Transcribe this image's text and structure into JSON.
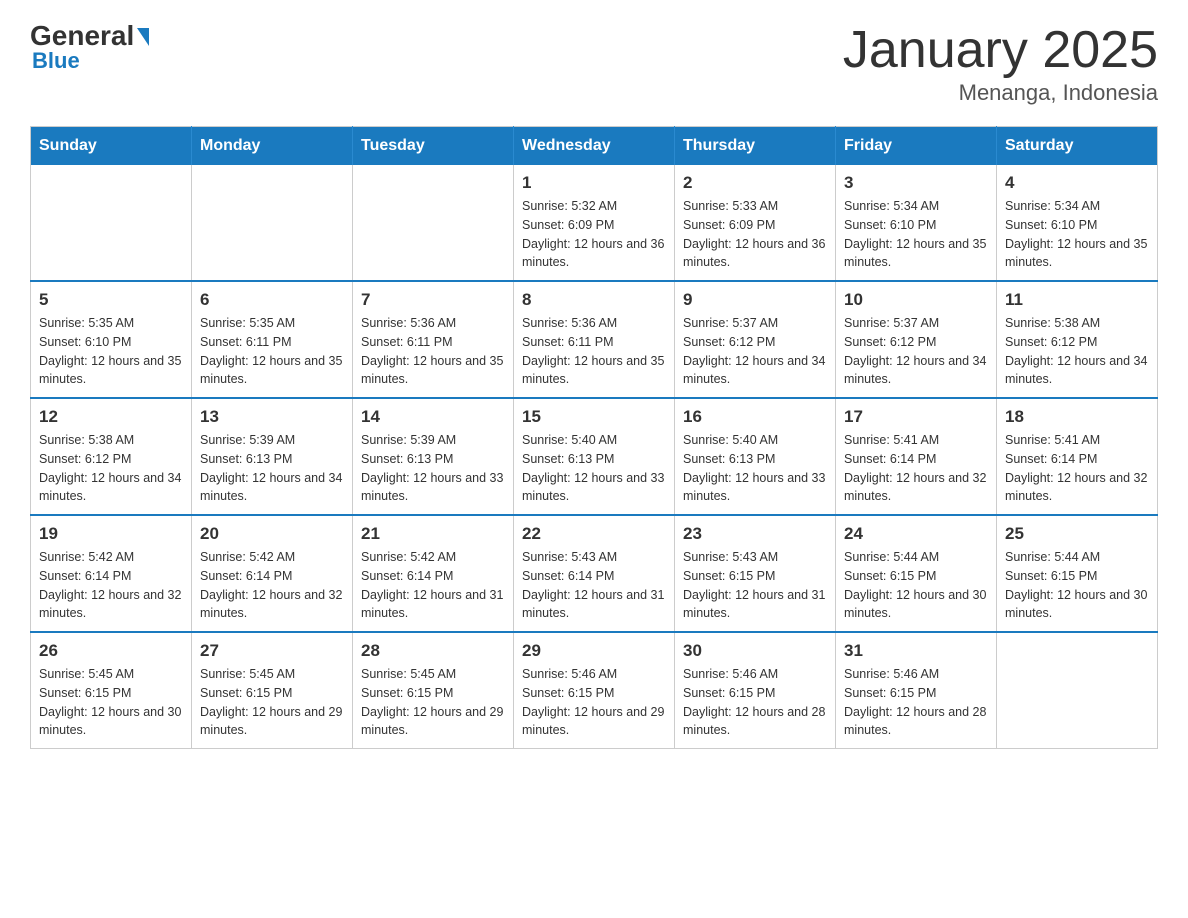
{
  "logo": {
    "general": "General",
    "blue": "Blue"
  },
  "title": "January 2025",
  "subtitle": "Menanga, Indonesia",
  "days_of_week": [
    "Sunday",
    "Monday",
    "Tuesday",
    "Wednesday",
    "Thursday",
    "Friday",
    "Saturday"
  ],
  "weeks": [
    [
      {
        "day": "",
        "sunrise": "",
        "sunset": "",
        "daylight": ""
      },
      {
        "day": "",
        "sunrise": "",
        "sunset": "",
        "daylight": ""
      },
      {
        "day": "",
        "sunrise": "",
        "sunset": "",
        "daylight": ""
      },
      {
        "day": "1",
        "sunrise": "Sunrise: 5:32 AM",
        "sunset": "Sunset: 6:09 PM",
        "daylight": "Daylight: 12 hours and 36 minutes."
      },
      {
        "day": "2",
        "sunrise": "Sunrise: 5:33 AM",
        "sunset": "Sunset: 6:09 PM",
        "daylight": "Daylight: 12 hours and 36 minutes."
      },
      {
        "day": "3",
        "sunrise": "Sunrise: 5:34 AM",
        "sunset": "Sunset: 6:10 PM",
        "daylight": "Daylight: 12 hours and 35 minutes."
      },
      {
        "day": "4",
        "sunrise": "Sunrise: 5:34 AM",
        "sunset": "Sunset: 6:10 PM",
        "daylight": "Daylight: 12 hours and 35 minutes."
      }
    ],
    [
      {
        "day": "5",
        "sunrise": "Sunrise: 5:35 AM",
        "sunset": "Sunset: 6:10 PM",
        "daylight": "Daylight: 12 hours and 35 minutes."
      },
      {
        "day": "6",
        "sunrise": "Sunrise: 5:35 AM",
        "sunset": "Sunset: 6:11 PM",
        "daylight": "Daylight: 12 hours and 35 minutes."
      },
      {
        "day": "7",
        "sunrise": "Sunrise: 5:36 AM",
        "sunset": "Sunset: 6:11 PM",
        "daylight": "Daylight: 12 hours and 35 minutes."
      },
      {
        "day": "8",
        "sunrise": "Sunrise: 5:36 AM",
        "sunset": "Sunset: 6:11 PM",
        "daylight": "Daylight: 12 hours and 35 minutes."
      },
      {
        "day": "9",
        "sunrise": "Sunrise: 5:37 AM",
        "sunset": "Sunset: 6:12 PM",
        "daylight": "Daylight: 12 hours and 34 minutes."
      },
      {
        "day": "10",
        "sunrise": "Sunrise: 5:37 AM",
        "sunset": "Sunset: 6:12 PM",
        "daylight": "Daylight: 12 hours and 34 minutes."
      },
      {
        "day": "11",
        "sunrise": "Sunrise: 5:38 AM",
        "sunset": "Sunset: 6:12 PM",
        "daylight": "Daylight: 12 hours and 34 minutes."
      }
    ],
    [
      {
        "day": "12",
        "sunrise": "Sunrise: 5:38 AM",
        "sunset": "Sunset: 6:12 PM",
        "daylight": "Daylight: 12 hours and 34 minutes."
      },
      {
        "day": "13",
        "sunrise": "Sunrise: 5:39 AM",
        "sunset": "Sunset: 6:13 PM",
        "daylight": "Daylight: 12 hours and 34 minutes."
      },
      {
        "day": "14",
        "sunrise": "Sunrise: 5:39 AM",
        "sunset": "Sunset: 6:13 PM",
        "daylight": "Daylight: 12 hours and 33 minutes."
      },
      {
        "day": "15",
        "sunrise": "Sunrise: 5:40 AM",
        "sunset": "Sunset: 6:13 PM",
        "daylight": "Daylight: 12 hours and 33 minutes."
      },
      {
        "day": "16",
        "sunrise": "Sunrise: 5:40 AM",
        "sunset": "Sunset: 6:13 PM",
        "daylight": "Daylight: 12 hours and 33 minutes."
      },
      {
        "day": "17",
        "sunrise": "Sunrise: 5:41 AM",
        "sunset": "Sunset: 6:14 PM",
        "daylight": "Daylight: 12 hours and 32 minutes."
      },
      {
        "day": "18",
        "sunrise": "Sunrise: 5:41 AM",
        "sunset": "Sunset: 6:14 PM",
        "daylight": "Daylight: 12 hours and 32 minutes."
      }
    ],
    [
      {
        "day": "19",
        "sunrise": "Sunrise: 5:42 AM",
        "sunset": "Sunset: 6:14 PM",
        "daylight": "Daylight: 12 hours and 32 minutes."
      },
      {
        "day": "20",
        "sunrise": "Sunrise: 5:42 AM",
        "sunset": "Sunset: 6:14 PM",
        "daylight": "Daylight: 12 hours and 32 minutes."
      },
      {
        "day": "21",
        "sunrise": "Sunrise: 5:42 AM",
        "sunset": "Sunset: 6:14 PM",
        "daylight": "Daylight: 12 hours and 31 minutes."
      },
      {
        "day": "22",
        "sunrise": "Sunrise: 5:43 AM",
        "sunset": "Sunset: 6:14 PM",
        "daylight": "Daylight: 12 hours and 31 minutes."
      },
      {
        "day": "23",
        "sunrise": "Sunrise: 5:43 AM",
        "sunset": "Sunset: 6:15 PM",
        "daylight": "Daylight: 12 hours and 31 minutes."
      },
      {
        "day": "24",
        "sunrise": "Sunrise: 5:44 AM",
        "sunset": "Sunset: 6:15 PM",
        "daylight": "Daylight: 12 hours and 30 minutes."
      },
      {
        "day": "25",
        "sunrise": "Sunrise: 5:44 AM",
        "sunset": "Sunset: 6:15 PM",
        "daylight": "Daylight: 12 hours and 30 minutes."
      }
    ],
    [
      {
        "day": "26",
        "sunrise": "Sunrise: 5:45 AM",
        "sunset": "Sunset: 6:15 PM",
        "daylight": "Daylight: 12 hours and 30 minutes."
      },
      {
        "day": "27",
        "sunrise": "Sunrise: 5:45 AM",
        "sunset": "Sunset: 6:15 PM",
        "daylight": "Daylight: 12 hours and 29 minutes."
      },
      {
        "day": "28",
        "sunrise": "Sunrise: 5:45 AM",
        "sunset": "Sunset: 6:15 PM",
        "daylight": "Daylight: 12 hours and 29 minutes."
      },
      {
        "day": "29",
        "sunrise": "Sunrise: 5:46 AM",
        "sunset": "Sunset: 6:15 PM",
        "daylight": "Daylight: 12 hours and 29 minutes."
      },
      {
        "day": "30",
        "sunrise": "Sunrise: 5:46 AM",
        "sunset": "Sunset: 6:15 PM",
        "daylight": "Daylight: 12 hours and 28 minutes."
      },
      {
        "day": "31",
        "sunrise": "Sunrise: 5:46 AM",
        "sunset": "Sunset: 6:15 PM",
        "daylight": "Daylight: 12 hours and 28 minutes."
      },
      {
        "day": "",
        "sunrise": "",
        "sunset": "",
        "daylight": ""
      }
    ]
  ]
}
